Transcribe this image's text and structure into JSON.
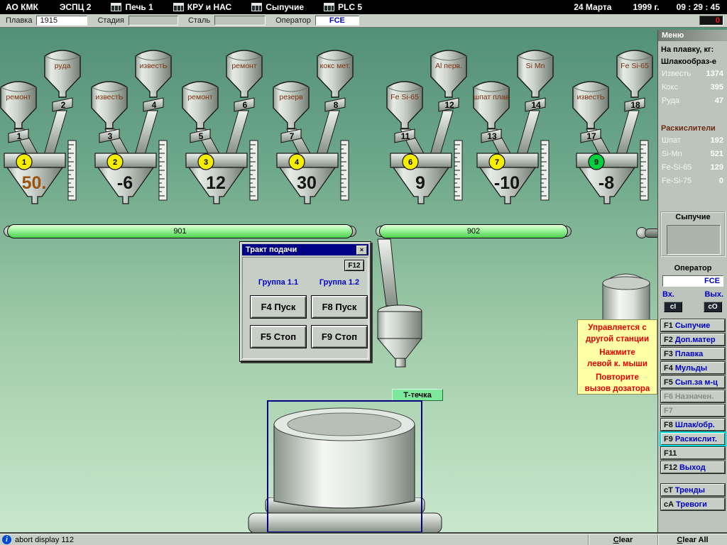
{
  "topbar": {
    "company": "АО КМК",
    "shop": "ЭСПЦ 2",
    "windows": [
      {
        "label": "Печь 1"
      },
      {
        "label": "КРУ и НАС"
      },
      {
        "label": "Сыпучие"
      },
      {
        "label": "PLC 5"
      }
    ],
    "date": "24 Марта",
    "year": "1999 г.",
    "time": "09 : 29 : 45"
  },
  "toolbar": {
    "melt_label": "Плавка",
    "melt_value": "1915",
    "stage_label": "Стадия",
    "stage_value": "",
    "steel_label": "Сталь",
    "steel_value": "",
    "operator_label": "Оператор",
    "operator_value": "FCE",
    "alarm_count": "0"
  },
  "stations": [
    {
      "front_label": "ремонт",
      "front_num": "1",
      "back_label": "руда",
      "back_num": "2",
      "circle": "1",
      "circle_color": "#f6ee00",
      "value": "50.",
      "value_color": "#9a5410"
    },
    {
      "front_label": "известЬ",
      "front_num": "3",
      "back_label": "известЬ",
      "back_num": "4",
      "circle": "2",
      "circle_color": "#f6ee00",
      "value": "-6",
      "value_color": "#141414"
    },
    {
      "front_label": "ремонт",
      "front_num": "5",
      "back_label": "ремонт",
      "back_num": "6",
      "circle": "3",
      "circle_color": "#f6ee00",
      "value": "12",
      "value_color": "#141414"
    },
    {
      "front_label": "резерв",
      "front_num": "7",
      "back_label": "кокс мет.",
      "back_num": "8",
      "circle": "4",
      "circle_color": "#f6ee00",
      "value": "30",
      "value_color": "#141414"
    },
    {
      "front_label": "Fe Si-65",
      "front_num": "11",
      "back_label": "Al перв.",
      "back_num": "12",
      "circle": "6",
      "circle_color": "#f6ee00",
      "value": "9",
      "value_color": "#141414"
    },
    {
      "front_label": "шпат плав",
      "front_num": "13",
      "back_label": "Si Mn",
      "back_num": "14",
      "circle": "7",
      "circle_color": "#f6ee00",
      "value": "-10",
      "value_color": "#141414"
    },
    {
      "front_label": "известЬ",
      "front_num": "17",
      "back_label": "Fe Si-65",
      "back_num": "18",
      "circle": "9",
      "circle_color": "#00d040",
      "value": "-8",
      "value_color": "#141414"
    }
  ],
  "conveyors": [
    {
      "label": "901"
    },
    {
      "label": "902"
    }
  ],
  "chute_label": "Т-течка",
  "dialog": {
    "title": "Тракт подачи",
    "close_glyph": "×",
    "f12_label": "F12",
    "group1": "Группа 1.1",
    "group2": "Группа 1.2",
    "btn_start1": "F4 Пуск",
    "btn_start2": "F8 Пуск",
    "btn_stop1": "F5 Стоп",
    "btn_stop2": "F9 Стоп"
  },
  "message": {
    "lines": [
      "Управляется с",
      "другой станции",
      "Нажмите",
      "левой к. мыши",
      "Повторите",
      "вызов дозатора"
    ]
  },
  "sidebar": {
    "menu_title": "Меню",
    "header": "На плавку, кг:",
    "section1": "Шлакообраз-е",
    "rows1": [
      {
        "label": "Известь",
        "value": "1374"
      },
      {
        "label": "Кокс",
        "value": "395"
      },
      {
        "label": "Руда",
        "value": "47"
      }
    ],
    "section2": "Раскислители",
    "rows2": [
      {
        "label": "Шпат",
        "value": "192"
      },
      {
        "label": "Si-Mn",
        "value": "521"
      },
      {
        "label": "Fe-Si-65",
        "value": "129"
      },
      {
        "label": "Fe-Si-75",
        "value": "0"
      }
    ],
    "bulk_title": "Сыпучие",
    "operator_title": "Оператор",
    "operator_value": "FCE",
    "in_label": "Вх.",
    "out_label": "Вых.",
    "in_key": "cI",
    "out_key": "cO",
    "fkeys": [
      {
        "key": "F1",
        "label": "Сыпучие"
      },
      {
        "key": "F2",
        "label": "Доп.матер"
      },
      {
        "key": "F3",
        "label": "Плавка"
      },
      {
        "key": "F4",
        "label": "Мульды"
      },
      {
        "key": "F5",
        "label": "Сып.за м-ц"
      },
      {
        "key": "F6",
        "label": "Назначен."
      },
      {
        "key": "F7",
        "label": ""
      },
      {
        "key": "F8",
        "label": "Шлак/обр."
      },
      {
        "key": "F9",
        "label": "Раскислит."
      },
      {
        "key": "F11",
        "label": ""
      },
      {
        "key": "F12",
        "label": "Выход"
      }
    ],
    "hotkeys": [
      {
        "key": "cT",
        "label": "Тренды"
      },
      {
        "key": "cA",
        "label": "Тревоги"
      }
    ]
  },
  "statusbar": {
    "info_glyph": "i",
    "text": "abort display 112",
    "clear": "Clear",
    "clear_all": "Clear All"
  }
}
